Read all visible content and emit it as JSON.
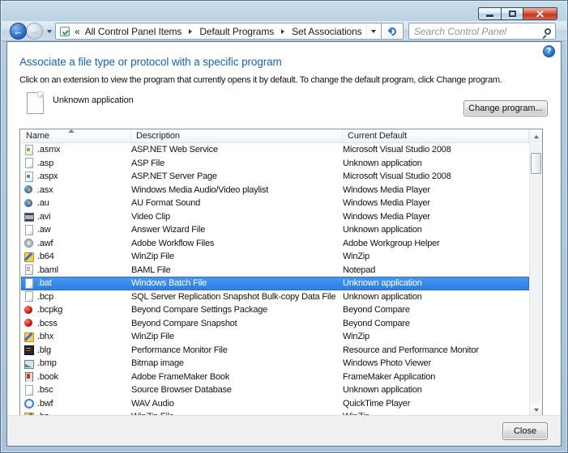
{
  "toolbar": {
    "breadcrumb_overflow": "«",
    "breadcrumb": [
      "All Control Panel Items",
      "Default Programs",
      "Set Associations"
    ],
    "search_placeholder": "Search Control Panel"
  },
  "content": {
    "heading": "Associate a file type or protocol with a specific program",
    "instruction": "Click on an extension to view the program that currently opens it by default. To change the default program, click Change program.",
    "selected_file_type_label": "Unknown application",
    "change_program_button": "Change program...",
    "help_glyph": "?"
  },
  "colors": {
    "heading_blue": "#1e62a8",
    "selection_blue": "#3d93ec",
    "frame_aero": "#b4ccdf"
  },
  "list": {
    "columns": [
      "Name",
      "Description",
      "Current Default"
    ],
    "sort": {
      "column": "Name",
      "direction": "ascending"
    },
    "selected_extension": ".bat",
    "rows": [
      {
        "ext": ".asmx",
        "desc": "ASP.NET Web Service",
        "app": "Microsoft Visual Studio 2008",
        "icon": "doc-code",
        "selected": false
      },
      {
        "ext": ".asp",
        "desc": "ASP File",
        "app": "Unknown application",
        "icon": "file",
        "selected": false
      },
      {
        "ext": ".aspx",
        "desc": "ASP.NET Server Page",
        "app": "Microsoft Visual Studio 2008",
        "icon": "doc-web",
        "selected": false
      },
      {
        "ext": ".asx",
        "desc": "Windows Media Audio/Video playlist",
        "app": "Windows Media Player",
        "icon": "wmp",
        "selected": false
      },
      {
        "ext": ".au",
        "desc": "AU Format Sound",
        "app": "Windows Media Player",
        "icon": "wmp",
        "selected": false
      },
      {
        "ext": ".avi",
        "desc": "Video Clip",
        "app": "Windows Media Player",
        "icon": "film",
        "selected": false
      },
      {
        "ext": ".aw",
        "desc": "Answer Wizard File",
        "app": "Unknown application",
        "icon": "file",
        "selected": false
      },
      {
        "ext": ".awf",
        "desc": "Adobe Workflow Files",
        "app": "Adobe Workgroup Helper",
        "icon": "adobe",
        "selected": false
      },
      {
        "ext": ".b64",
        "desc": "WinZip File",
        "app": "WinZip",
        "icon": "winzip",
        "selected": false
      },
      {
        "ext": ".baml",
        "desc": "BAML File",
        "app": "Notepad",
        "icon": "doc-text",
        "selected": false
      },
      {
        "ext": ".bat",
        "desc": "Windows Batch File",
        "app": "Unknown application",
        "icon": "file",
        "selected": true
      },
      {
        "ext": ".bcp",
        "desc": "SQL Server Replication Snapshot Bulk-copy Data File",
        "app": "Unknown application",
        "icon": "file",
        "selected": false
      },
      {
        "ext": ".bcpkg",
        "desc": "Beyond Compare Settings Package",
        "app": "Beyond Compare",
        "icon": "bc",
        "selected": false
      },
      {
        "ext": ".bcss",
        "desc": "Beyond Compare Snapshot",
        "app": "Beyond Compare",
        "icon": "bc",
        "selected": false
      },
      {
        "ext": ".bhx",
        "desc": "WinZip File",
        "app": "WinZip",
        "icon": "winzip",
        "selected": false
      },
      {
        "ext": ".blg",
        "desc": "Performance Monitor File",
        "app": "Resource and Performance Monitor",
        "icon": "perf",
        "selected": false
      },
      {
        "ext": ".bmp",
        "desc": "Bitmap image",
        "app": "Windows Photo Viewer",
        "icon": "image",
        "selected": false
      },
      {
        "ext": ".book",
        "desc": "Adobe FrameMaker Book",
        "app": "FrameMaker Application",
        "icon": "book",
        "selected": false
      },
      {
        "ext": ".bsc",
        "desc": "Source Browser Database",
        "app": "Unknown application",
        "icon": "file",
        "selected": false
      },
      {
        "ext": ".bwf",
        "desc": "WAV Audio",
        "app": "QuickTime Player",
        "icon": "qt",
        "selected": false
      },
      {
        "ext": ".bz",
        "desc": "WinZip File",
        "app": "WinZip",
        "icon": "winzip",
        "selected": false
      }
    ]
  },
  "footer": {
    "close_button": "Close"
  }
}
